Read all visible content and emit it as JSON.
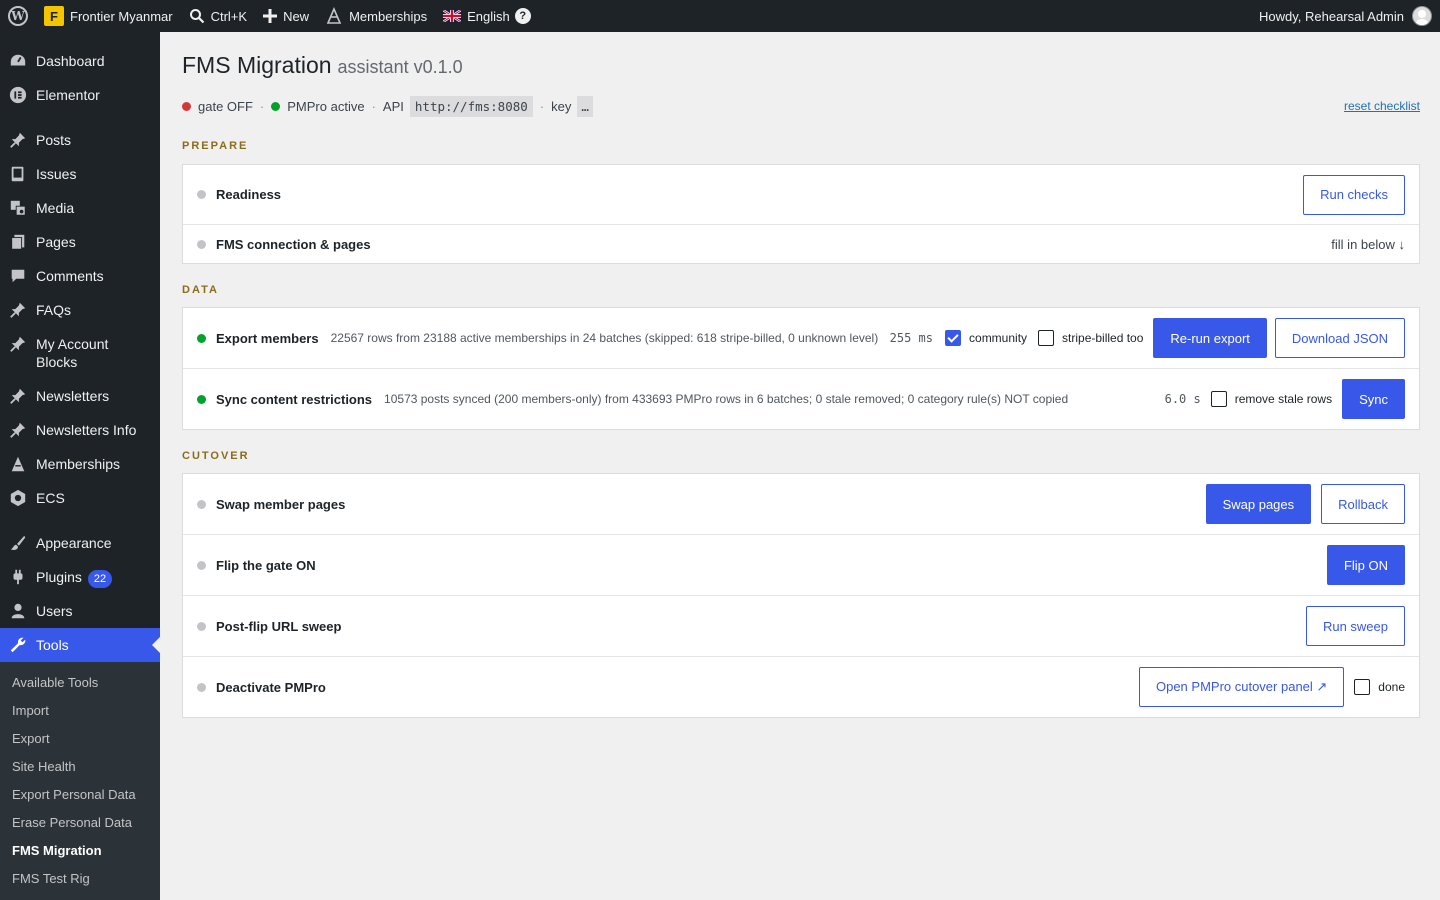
{
  "adminbar": {
    "site_name": "Frontier Myanmar",
    "site_logo_letter": "F",
    "search_label": "Ctrl+K",
    "new_label": "New",
    "memberships_label": "Memberships",
    "language_label": "English",
    "help_glyph": "?",
    "howdy": "Howdy, Rehearsal Admin"
  },
  "sidebar": {
    "items": [
      {
        "label": "Dashboard",
        "icon": "dashboard-icon"
      },
      {
        "label": "Elementor",
        "icon": "elementor-icon"
      },
      {
        "label": "Posts",
        "icon": "pin-icon"
      },
      {
        "label": "Issues",
        "icon": "book-icon"
      },
      {
        "label": "Media",
        "icon": "media-icon"
      },
      {
        "label": "Pages",
        "icon": "pages-icon"
      },
      {
        "label": "Comments",
        "icon": "comment-icon"
      },
      {
        "label": "FAQs",
        "icon": "pin-icon"
      },
      {
        "label": "My Account Blocks",
        "icon": "pin-icon"
      },
      {
        "label": "Newsletters",
        "icon": "pin-icon"
      },
      {
        "label": "Newsletters Info",
        "icon": "pin-icon"
      },
      {
        "label": "Memberships",
        "icon": "memberships-icon"
      },
      {
        "label": "ECS",
        "icon": "ecs-icon"
      },
      {
        "label": "Appearance",
        "icon": "brush-icon"
      },
      {
        "label": "Plugins",
        "icon": "plugin-icon",
        "badge": "22"
      },
      {
        "label": "Users",
        "icon": "user-icon"
      },
      {
        "label": "Tools",
        "icon": "wrench-icon"
      }
    ],
    "submenu": [
      "Available Tools",
      "Import",
      "Export",
      "Site Health",
      "Export Personal Data",
      "Erase Personal Data",
      "FMS Migration",
      "FMS Test Rig"
    ]
  },
  "header": {
    "title": "FMS Migration",
    "version": "assistant v0.1.0"
  },
  "status": {
    "gate": "gate OFF",
    "pmpro": "PMPro active",
    "api_label": "API",
    "api_url": "http://fms:8080",
    "key_label": "key",
    "key_value": "…",
    "reset_link": "reset checklist",
    "separator": "·"
  },
  "sections": {
    "prepare": {
      "label": "PREPARE",
      "readiness": {
        "title": "Readiness",
        "button": "Run checks"
      },
      "connection": {
        "title": "FMS connection & pages",
        "hint": "fill in below ↓"
      }
    },
    "data": {
      "label": "DATA",
      "export": {
        "title": "Export members",
        "detail": "22567 rows from 23188 active memberships in 24 batches (skipped: 618 stripe-billed, 0 unknown level)",
        "timing": "255 ms",
        "community_label": "community",
        "stripe_label": "stripe-billed too",
        "rerun_button": "Re-run export",
        "download_button": "Download JSON"
      },
      "sync": {
        "title": "Sync content restrictions",
        "detail": "10573 posts synced (200 members-only) from 433693 PMPro rows in 6 batches; 0 stale removed; 0 category rule(s) NOT copied",
        "timing": "6.0 s",
        "stale_label": "remove stale rows",
        "button": "Sync"
      }
    },
    "cutover": {
      "label": "CUTOVER",
      "swap": {
        "title": "Swap member pages",
        "swap_button": "Swap pages",
        "rollback_button": "Rollback"
      },
      "flip": {
        "title": "Flip the gate ON",
        "button": "Flip ON"
      },
      "sweep": {
        "title": "Post-flip URL sweep",
        "button": "Run sweep"
      },
      "deactivate": {
        "title": "Deactivate PMPro",
        "button": "Open PMPro cutover panel ↗",
        "done_label": "done"
      }
    }
  },
  "colors": {
    "accent": "#3858e9",
    "admin_dark": "#1d2327",
    "status_red": "#d63638",
    "status_green": "#00a32a",
    "section_label": "#8a6d1a"
  }
}
